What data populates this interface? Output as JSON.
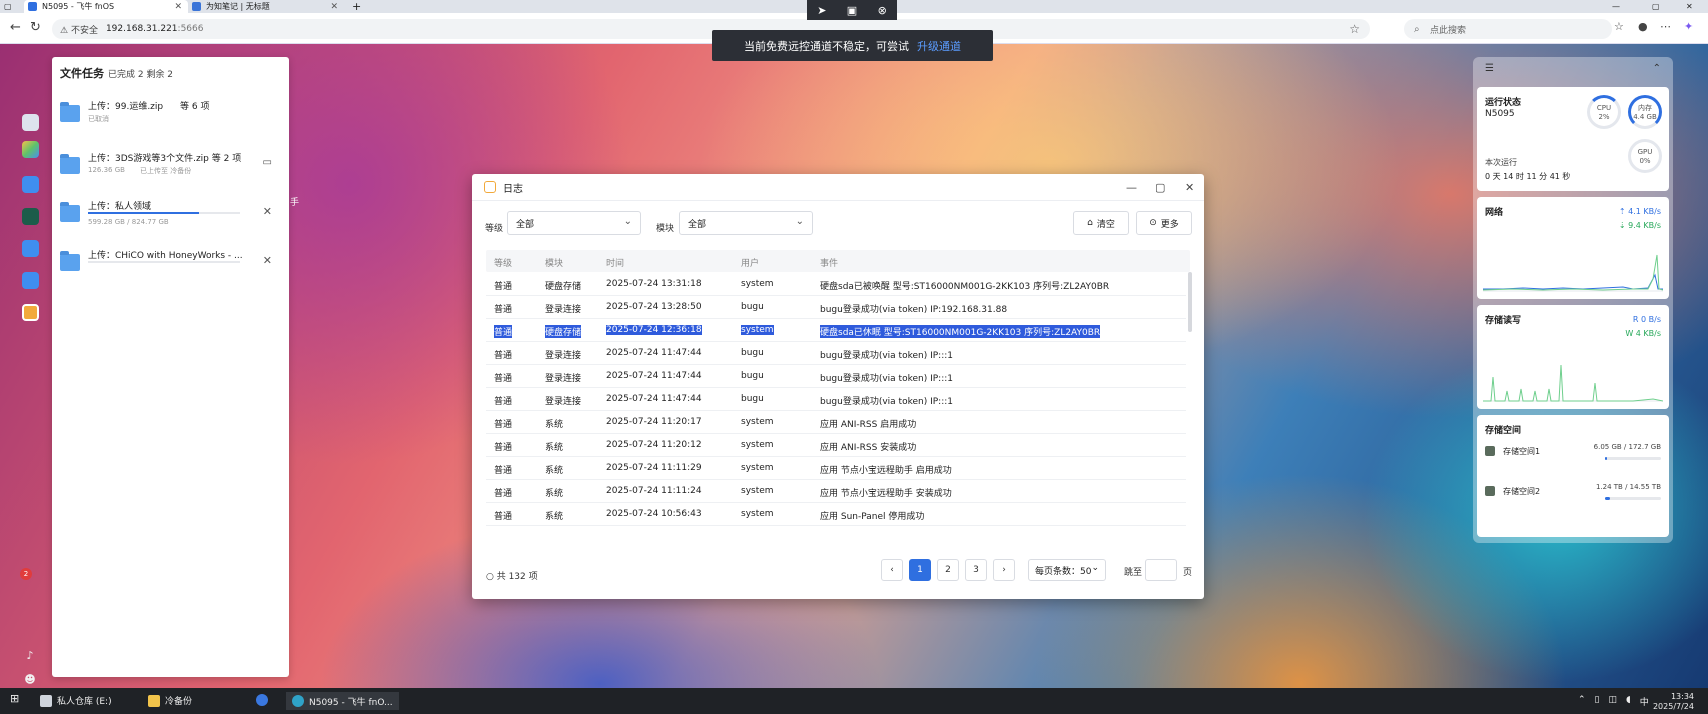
{
  "browser": {
    "tabs": [
      {
        "label": "N5095 - 飞牛 fnOS"
      },
      {
        "label": "为知笔记 | 无标题"
      }
    ],
    "address": {
      "insecure_label": "不安全",
      "host": "192.168.31.221",
      "port": ":5666"
    },
    "search_placeholder": "点此搜索"
  },
  "notice": {
    "text": "当前免费远控通道不稳定，可尝试",
    "link": "升级通道"
  },
  "badge_count": "2",
  "file_tasks": {
    "title": "文件任务",
    "summary": "已完成 2 剩余 2",
    "items": [
      {
        "name": "上传：99.运维.zip",
        "count": "等 6 项",
        "status": "已取消"
      },
      {
        "name": "上传：3DS游戏等3个文件.zip 等 2 项",
        "size": "126.36 GB",
        "status": "已上传至 冷备份"
      },
      {
        "name": "上传：私人领域",
        "size": "599.28 GB / 824.77 GB",
        "progress": 0.73
      },
      {
        "name": "上传：CHiCO with HoneyWorks - ...",
        "progress": 0.0
      }
    ]
  },
  "desktop_text": "手",
  "log_window": {
    "title": "日志",
    "filters": {
      "level_label": "等级",
      "level_value": "全部",
      "module_label": "模块",
      "module_value": "全部",
      "clear_label": "清空",
      "more_label": "更多"
    },
    "columns": [
      "等级",
      "模块",
      "时间",
      "用户",
      "事件"
    ],
    "rows": [
      [
        "普通",
        "硬盘存储",
        "2025-07-24 13:31:18",
        "system",
        "硬盘sda已被唤醒 型号:ST16000NM001G-2KK103 序列号:ZL2AY0BR"
      ],
      [
        "普通",
        "登录连接",
        "2025-07-24 13:28:50",
        "bugu",
        "bugu登录成功(via token) IP:192.168.31.88"
      ],
      [
        "普通",
        "硬盘存储",
        "2025-07-24 12:36:18",
        "system",
        "硬盘sda已休眠 型号:ST16000NM001G-2KK103 序列号:ZL2AY0BR"
      ],
      [
        "普通",
        "登录连接",
        "2025-07-24 11:47:44",
        "bugu",
        "bugu登录成功(via token) IP:::1"
      ],
      [
        "普通",
        "登录连接",
        "2025-07-24 11:47:44",
        "bugu",
        "bugu登录成功(via token) IP:::1"
      ],
      [
        "普通",
        "登录连接",
        "2025-07-24 11:47:44",
        "bugu",
        "bugu登录成功(via token) IP:::1"
      ],
      [
        "普通",
        "系统",
        "2025-07-24 11:20:17",
        "system",
        "应用 ANI-RSS 启用成功"
      ],
      [
        "普通",
        "系统",
        "2025-07-24 11:20:12",
        "system",
        "应用 ANI-RSS 安装成功"
      ],
      [
        "普通",
        "系统",
        "2025-07-24 11:11:29",
        "system",
        "应用 节点小宝远程助手 启用成功"
      ],
      [
        "普通",
        "系统",
        "2025-07-24 11:11:24",
        "system",
        "应用 节点小宝远程助手 安装成功"
      ],
      [
        "普通",
        "系统",
        "2025-07-24 10:56:43",
        "system",
        "应用 Sun-Panel 停用成功"
      ]
    ],
    "selected_row": 2,
    "footer": {
      "total": "共 132 项",
      "pages": [
        "1",
        "2",
        "3"
      ],
      "current_page": "1",
      "per_page": "每页条数：50",
      "jump_label": "跳至",
      "jump_suffix": "页"
    }
  },
  "widgets": {
    "status": {
      "title": "运行状态",
      "device": "N5095",
      "cpu_label": "CPU",
      "cpu_value": "2%",
      "mem_label": "内存",
      "mem_value": "4.4 GB",
      "gpu_label": "GPU",
      "gpu_value": "0%",
      "uptime_label": "本次运行",
      "uptime_value": "0 天 14 时 11 分 41 秒"
    },
    "network": {
      "title": "网络",
      "up": "4.1 KB/s",
      "down": "9.4 KB/s"
    },
    "disk_io": {
      "title": "存储读写",
      "read": "R  0 B/s",
      "write": "W  4 KB/s"
    },
    "storage": {
      "title": "存储空间",
      "pools": [
        {
          "name": "存储空间1",
          "size": "6.05 GB / 172.7 GB",
          "usage": 0.04
        },
        {
          "name": "存储空间2",
          "size": "1.24 TB / 14.55 TB",
          "usage": 0.09
        }
      ]
    }
  },
  "taskbar": {
    "items": [
      "私人仓库 (E:)",
      "冷备份",
      "N5095 - 飞牛 fnO..."
    ],
    "ime": "中",
    "time": "13:34",
    "date": "2025/7/24"
  },
  "colors": {
    "accent": "#2f6fe0",
    "selection": "#2f5bdc",
    "notice_bg": "#2c2f36"
  }
}
